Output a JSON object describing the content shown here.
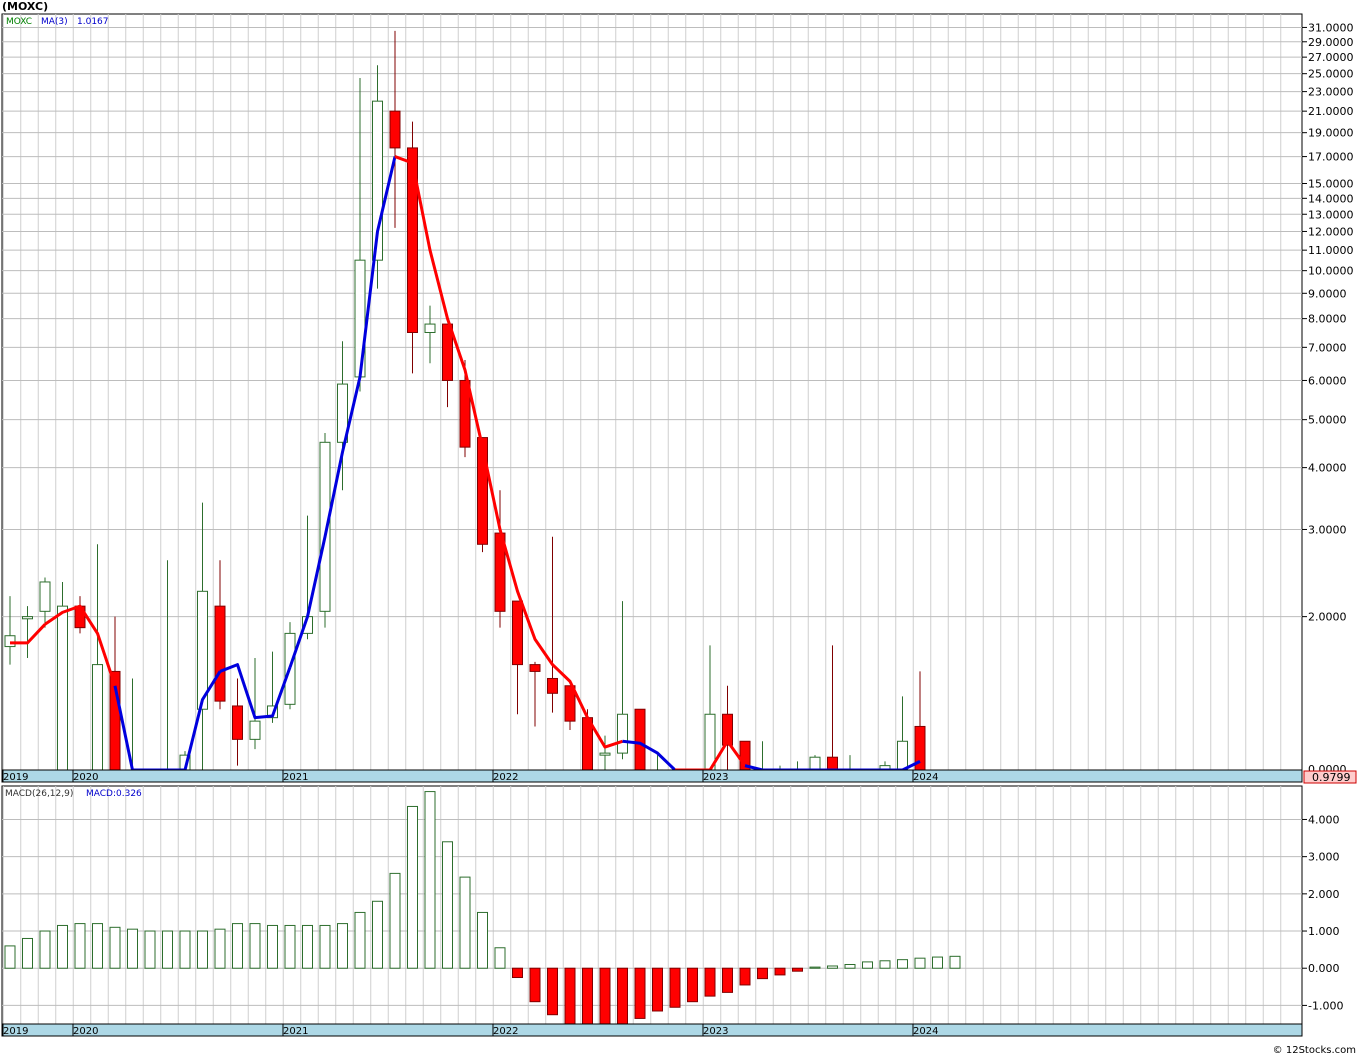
{
  "title": "(MOXC)",
  "copyright": "© 12Stocks.com",
  "chart_data": [
    {
      "type": "candlestick",
      "symbol": "MOXC",
      "ma_label": "MA(3)",
      "ma_value": "1.0167",
      "last_price_label": "0.9799",
      "y_scale": "log",
      "ylim": [
        0.9799,
        33.0
      ],
      "y_ticks": [
        {
          "v": 31,
          "label": "31.0000"
        },
        {
          "v": 29,
          "label": "29.0000"
        },
        {
          "v": 27,
          "label": "27.0000"
        },
        {
          "v": 25,
          "label": "25.0000"
        },
        {
          "v": 23,
          "label": "23.0000"
        },
        {
          "v": 21,
          "label": "21.0000"
        },
        {
          "v": 19,
          "label": "19.0000"
        },
        {
          "v": 17,
          "label": "17.0000"
        },
        {
          "v": 15,
          "label": "15.0000"
        },
        {
          "v": 14,
          "label": "14.0000"
        },
        {
          "v": 13,
          "label": "13.0000"
        },
        {
          "v": 12,
          "label": "12.0000"
        },
        {
          "v": 11,
          "label": "11.0000"
        },
        {
          "v": 10,
          "label": "10.0000"
        },
        {
          "v": 9,
          "label": "9.0000"
        },
        {
          "v": 8,
          "label": "8.0000"
        },
        {
          "v": 7,
          "label": "7.0000"
        },
        {
          "v": 6,
          "label": "6.0000"
        },
        {
          "v": 5,
          "label": "5.0000"
        },
        {
          "v": 4,
          "label": "4.0000"
        },
        {
          "v": 3,
          "label": "3.0000"
        },
        {
          "v": 2,
          "label": "2.0000"
        }
      ],
      "bottom_tick_label": "0.0000",
      "x_years": [
        {
          "i": 0,
          "label": "2019"
        },
        {
          "i": 4,
          "label": "2020"
        },
        {
          "i": 16,
          "label": "2021"
        },
        {
          "i": 28,
          "label": "2022"
        },
        {
          "i": 40,
          "label": "2023"
        },
        {
          "i": 52,
          "label": "2024"
        }
      ],
      "candles": [
        {
          "o": 1.74,
          "h": 2.2,
          "l": 1.6,
          "c": 1.83
        },
        {
          "o": 1.98,
          "h": 2.1,
          "l": 1.65,
          "c": 2.0
        },
        {
          "o": 2.05,
          "h": 2.4,
          "l": 1.9,
          "c": 2.35
        },
        {
          "o": 0.98,
          "h": 2.35,
          "l": 0.98,
          "c": 2.1
        },
        {
          "o": 2.1,
          "h": 2.2,
          "l": 1.85,
          "c": 1.9
        },
        {
          "o": 0.98,
          "h": 2.8,
          "l": 0.98,
          "c": 1.6
        },
        {
          "o": 1.55,
          "h": 2.0,
          "l": 0.98,
          "c": 0.98
        },
        {
          "o": 0.98,
          "h": 1.5,
          "l": 0.98,
          "c": 0.98
        },
        {
          "o": 0.98,
          "h": 0.98,
          "l": 0.98,
          "c": 0.98
        },
        {
          "o": 0.98,
          "h": 2.6,
          "l": 0.98,
          "c": 0.98
        },
        {
          "o": 0.98,
          "h": 1.07,
          "l": 0.98,
          "c": 1.05
        },
        {
          "o": 1.3,
          "h": 3.4,
          "l": 0.98,
          "c": 2.25
        },
        {
          "o": 2.1,
          "h": 2.6,
          "l": 1.3,
          "c": 1.35
        },
        {
          "o": 1.32,
          "h": 1.5,
          "l": 1.0,
          "c": 1.13
        },
        {
          "o": 1.13,
          "h": 1.65,
          "l": 1.08,
          "c": 1.23
        },
        {
          "o": 1.25,
          "h": 1.7,
          "l": 1.22,
          "c": 1.32
        },
        {
          "o": 1.33,
          "h": 1.95,
          "l": 1.3,
          "c": 1.85
        },
        {
          "o": 1.85,
          "h": 3.2,
          "l": 1.8,
          "c": 2.0
        },
        {
          "o": 2.05,
          "h": 4.7,
          "l": 1.9,
          "c": 4.5
        },
        {
          "o": 4.5,
          "h": 7.2,
          "l": 3.6,
          "c": 5.9
        },
        {
          "o": 6.1,
          "h": 24.5,
          "l": 5.7,
          "c": 10.5
        },
        {
          "o": 10.5,
          "h": 26.0,
          "l": 9.2,
          "c": 22.0
        },
        {
          "o": 21.0,
          "h": 30.5,
          "l": 12.2,
          "c": 17.7
        },
        {
          "o": 17.7,
          "h": 20.0,
          "l": 6.2,
          "c": 7.5
        },
        {
          "o": 7.5,
          "h": 8.5,
          "l": 6.5,
          "c": 7.8
        },
        {
          "o": 7.8,
          "h": 7.8,
          "l": 5.3,
          "c": 6.0
        },
        {
          "o": 6.0,
          "h": 6.6,
          "l": 4.2,
          "c": 4.4
        },
        {
          "o": 4.6,
          "h": 4.6,
          "l": 2.7,
          "c": 2.8
        },
        {
          "o": 2.95,
          "h": 3.6,
          "l": 1.9,
          "c": 2.05
        },
        {
          "o": 2.15,
          "h": 2.15,
          "l": 1.27,
          "c": 1.6
        },
        {
          "o": 1.6,
          "h": 1.62,
          "l": 1.2,
          "c": 1.55
        },
        {
          "o": 1.5,
          "h": 2.9,
          "l": 1.28,
          "c": 1.4
        },
        {
          "o": 1.45,
          "h": 1.45,
          "l": 1.18,
          "c": 1.23
        },
        {
          "o": 1.25,
          "h": 1.3,
          "l": 0.98,
          "c": 0.98
        },
        {
          "o": 1.05,
          "h": 1.15,
          "l": 0.98,
          "c": 1.06
        },
        {
          "o": 1.06,
          "h": 2.15,
          "l": 1.03,
          "c": 1.27
        },
        {
          "o": 1.3,
          "h": 1.3,
          "l": 0.98,
          "c": 0.98
        },
        {
          "o": 0.98,
          "h": 1.05,
          "l": 0.98,
          "c": 0.98
        },
        {
          "o": 0.98,
          "h": 0.98,
          "l": 0.98,
          "c": 0.98
        },
        {
          "o": 0.98,
          "h": 0.98,
          "l": 0.98,
          "c": 0.98
        },
        {
          "o": 0.98,
          "h": 1.75,
          "l": 0.98,
          "c": 1.27
        },
        {
          "o": 1.27,
          "h": 1.45,
          "l": 0.98,
          "c": 1.1
        },
        {
          "o": 1.12,
          "h": 1.12,
          "l": 0.98,
          "c": 0.98
        },
        {
          "o": 0.98,
          "h": 1.12,
          "l": 0.98,
          "c": 0.98
        },
        {
          "o": 0.98,
          "h": 1.0,
          "l": 0.98,
          "c": 0.98
        },
        {
          "o": 0.98,
          "h": 1.02,
          "l": 0.98,
          "c": 0.98
        },
        {
          "o": 0.98,
          "h": 1.05,
          "l": 0.98,
          "c": 1.04
        },
        {
          "o": 1.04,
          "h": 1.75,
          "l": 0.98,
          "c": 0.98
        },
        {
          "o": 0.98,
          "h": 1.05,
          "l": 0.98,
          "c": 0.98
        },
        {
          "o": 0.98,
          "h": 0.98,
          "l": 0.98,
          "c": 0.98
        },
        {
          "o": 0.98,
          "h": 1.02,
          "l": 0.98,
          "c": 1.0
        },
        {
          "o": 0.98,
          "h": 1.38,
          "l": 0.98,
          "c": 1.12
        },
        {
          "o": 1.2,
          "h": 1.55,
          "l": 0.98,
          "c": 0.98
        }
      ],
      "ma3": [
        1.77,
        1.77,
        1.93,
        2.04,
        2.1,
        1.85,
        1.45,
        0.9,
        0.8,
        0.8,
        0.9,
        1.36,
        1.55,
        1.6,
        1.25,
        1.26,
        1.58,
        2.0,
        2.9,
        4.3,
        6.1,
        12.0,
        17.0,
        16.5,
        11.0,
        8.0,
        6.3,
        4.4,
        3.0,
        2.25,
        1.8,
        1.6,
        1.48,
        1.25,
        1.09,
        1.12,
        1.11,
        1.06,
        0.9,
        0.8,
        0.9,
        1.12,
        1.0,
        0.9,
        0.9,
        0.9,
        0.9,
        0.9,
        0.9,
        0.9,
        0.9,
        0.9,
        1.02
      ],
      "ma3_color_split": [
        [
          0,
          2,
          "red"
        ],
        [
          2,
          6,
          "red"
        ],
        [
          6,
          12,
          "blue"
        ],
        [
          12,
          16,
          "blue"
        ],
        [
          16,
          22,
          "blue"
        ],
        [
          22,
          35,
          "red"
        ],
        [
          35,
          38,
          "blue"
        ],
        [
          38,
          42,
          "red"
        ],
        [
          42,
          52,
          "blue"
        ]
      ]
    },
    {
      "type": "bar",
      "indicator_label": "MACD(26,12,9)",
      "macd_label": "MACD:0.326",
      "ylim": [
        -1.5,
        4.9
      ],
      "y_ticks": [
        {
          "v": 4,
          "label": "4.000"
        },
        {
          "v": 3,
          "label": "3.000"
        },
        {
          "v": 2,
          "label": "2.000"
        },
        {
          "v": 1,
          "label": "1.000"
        },
        {
          "v": 0,
          "label": "0.000"
        },
        {
          "v": -1,
          "label": "-1.000"
        }
      ],
      "x_years": [
        {
          "i": 0,
          "label": "2019"
        },
        {
          "i": 4,
          "label": "2020"
        },
        {
          "i": 16,
          "label": "2021"
        },
        {
          "i": 28,
          "label": "2022"
        },
        {
          "i": 40,
          "label": "2023"
        },
        {
          "i": 52,
          "label": "2024"
        }
      ],
      "values": [
        0.6,
        0.8,
        1.0,
        1.15,
        1.2,
        1.2,
        1.1,
        1.05,
        1.0,
        1.0,
        1.0,
        1.0,
        1.05,
        1.2,
        1.2,
        1.15,
        1.15,
        1.15,
        1.15,
        1.2,
        1.5,
        1.8,
        2.55,
        4.35,
        4.75,
        3.4,
        2.45,
        1.5,
        0.55,
        -0.25,
        -0.9,
        -1.25,
        -1.5,
        -1.55,
        -1.55,
        -1.5,
        -1.35,
        -1.15,
        -1.05,
        -0.9,
        -0.75,
        -0.65,
        -0.45,
        -0.28,
        -0.18,
        -0.08,
        0.03,
        0.06,
        0.1,
        0.17,
        0.2,
        0.23,
        0.27,
        0.3,
        0.32
      ]
    }
  ]
}
